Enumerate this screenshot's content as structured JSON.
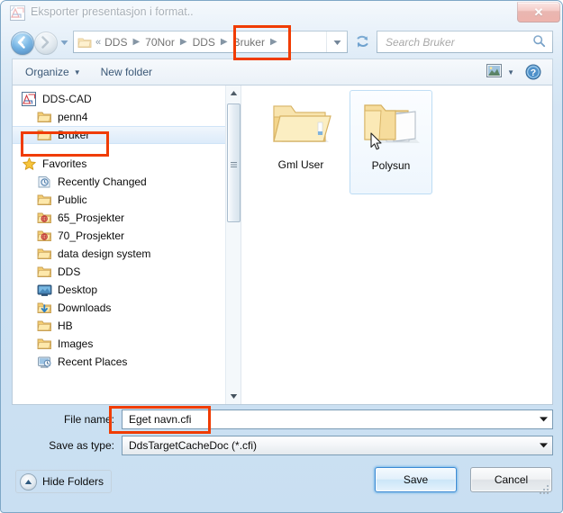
{
  "window": {
    "title": "Eksporter presentasjon i format..",
    "app_icon": "dds-cad-icon",
    "close_label": "✕"
  },
  "navbar": {
    "back_icon": "back-arrow-icon",
    "forward_icon": "forward-arrow-icon",
    "recent_pages_icon": "chevron-down-icon",
    "breadcrumb_folder_icon": "folder-icon",
    "overflow_chevrons": "«",
    "crumbs": [
      {
        "label": "DDS"
      },
      {
        "label": "70Nor"
      },
      {
        "label": "DDS"
      },
      {
        "label": "Bruker"
      }
    ],
    "crumb_separator": "▶",
    "address_dropdown_icon": "chevron-down-icon",
    "refresh_icon": "refresh-icon",
    "search": {
      "placeholder": "Search Bruker",
      "value": "",
      "icon": "search-icon"
    }
  },
  "toolbar": {
    "organize_label": "Organize",
    "organize_caret": "▼",
    "new_folder_label": "New folder",
    "views_icon": "views-icon",
    "views_caret": "▼",
    "help_icon": "help-icon",
    "help_glyph": "?"
  },
  "nav_pane": {
    "items": [
      {
        "label": "DDS-CAD",
        "icon": "dds-cad-icon",
        "indent": false,
        "selected": false,
        "gap_after": false
      },
      {
        "label": "penn4",
        "icon": "folder-icon",
        "indent": true,
        "selected": false,
        "gap_after": false
      },
      {
        "label": "Bruker",
        "icon": "folder-icon",
        "indent": true,
        "selected": true,
        "gap_after": true
      },
      {
        "label": "Favorites",
        "icon": "star-icon",
        "indent": false,
        "selected": false,
        "gap_after": false
      },
      {
        "label": "Recently Changed",
        "icon": "recently-changed-icon",
        "indent": true,
        "selected": false,
        "gap_after": false
      },
      {
        "label": "Public",
        "icon": "folder-icon",
        "indent": true,
        "selected": false,
        "gap_after": false
      },
      {
        "label": "65_Prosjekter",
        "icon": "network-folder-icon",
        "indent": true,
        "selected": false,
        "gap_after": false
      },
      {
        "label": "70_Prosjekter",
        "icon": "network-folder-icon",
        "indent": true,
        "selected": false,
        "gap_after": false
      },
      {
        "label": "data design system",
        "icon": "folder-icon",
        "indent": true,
        "selected": false,
        "gap_after": false
      },
      {
        "label": "DDS",
        "icon": "folder-icon",
        "indent": true,
        "selected": false,
        "gap_after": false
      },
      {
        "label": "Desktop",
        "icon": "desktop-icon",
        "indent": true,
        "selected": false,
        "gap_after": false
      },
      {
        "label": "Downloads",
        "icon": "downloads-icon",
        "indent": true,
        "selected": false,
        "gap_after": false
      },
      {
        "label": "HB",
        "icon": "folder-icon",
        "indent": true,
        "selected": false,
        "gap_after": false
      },
      {
        "label": "Images",
        "icon": "folder-icon",
        "indent": true,
        "selected": false,
        "gap_after": false
      },
      {
        "label": "Recent Places",
        "icon": "recent-places-icon",
        "indent": true,
        "selected": false,
        "gap_after": false
      }
    ],
    "scrollbar": {
      "up_arrow": "▲",
      "down_arrow": "▼"
    }
  },
  "file_pane": {
    "items": [
      {
        "label": "Gml User",
        "icon": "closed-folder-icon",
        "hovered": false
      },
      {
        "label": "Polysun",
        "icon": "open-folder-with-documents-icon",
        "hovered": true
      }
    ],
    "cursor": "arrow-cursor"
  },
  "form": {
    "file_name_label": "File name:",
    "file_name_value": "Eget navn.cfi",
    "file_name_dropdown_icon": "chevron-down-icon",
    "save_as_type_label": "Save as type:",
    "save_as_type_value": "DdsTargetCacheDoc (*.cfi)",
    "save_as_type_dropdown_icon": "chevron-down-icon"
  },
  "buttons": {
    "hide_folders_label": "Hide Folders",
    "hide_folders_icon": "chevron-up-circle-icon",
    "save_label": "Save",
    "cancel_label": "Cancel"
  },
  "annotations": {
    "color": "#f03c02",
    "boxes": [
      {
        "target": "breadcrumb-bruker"
      },
      {
        "target": "tree-item-bruker"
      },
      {
        "target": "file-name-field"
      }
    ]
  }
}
